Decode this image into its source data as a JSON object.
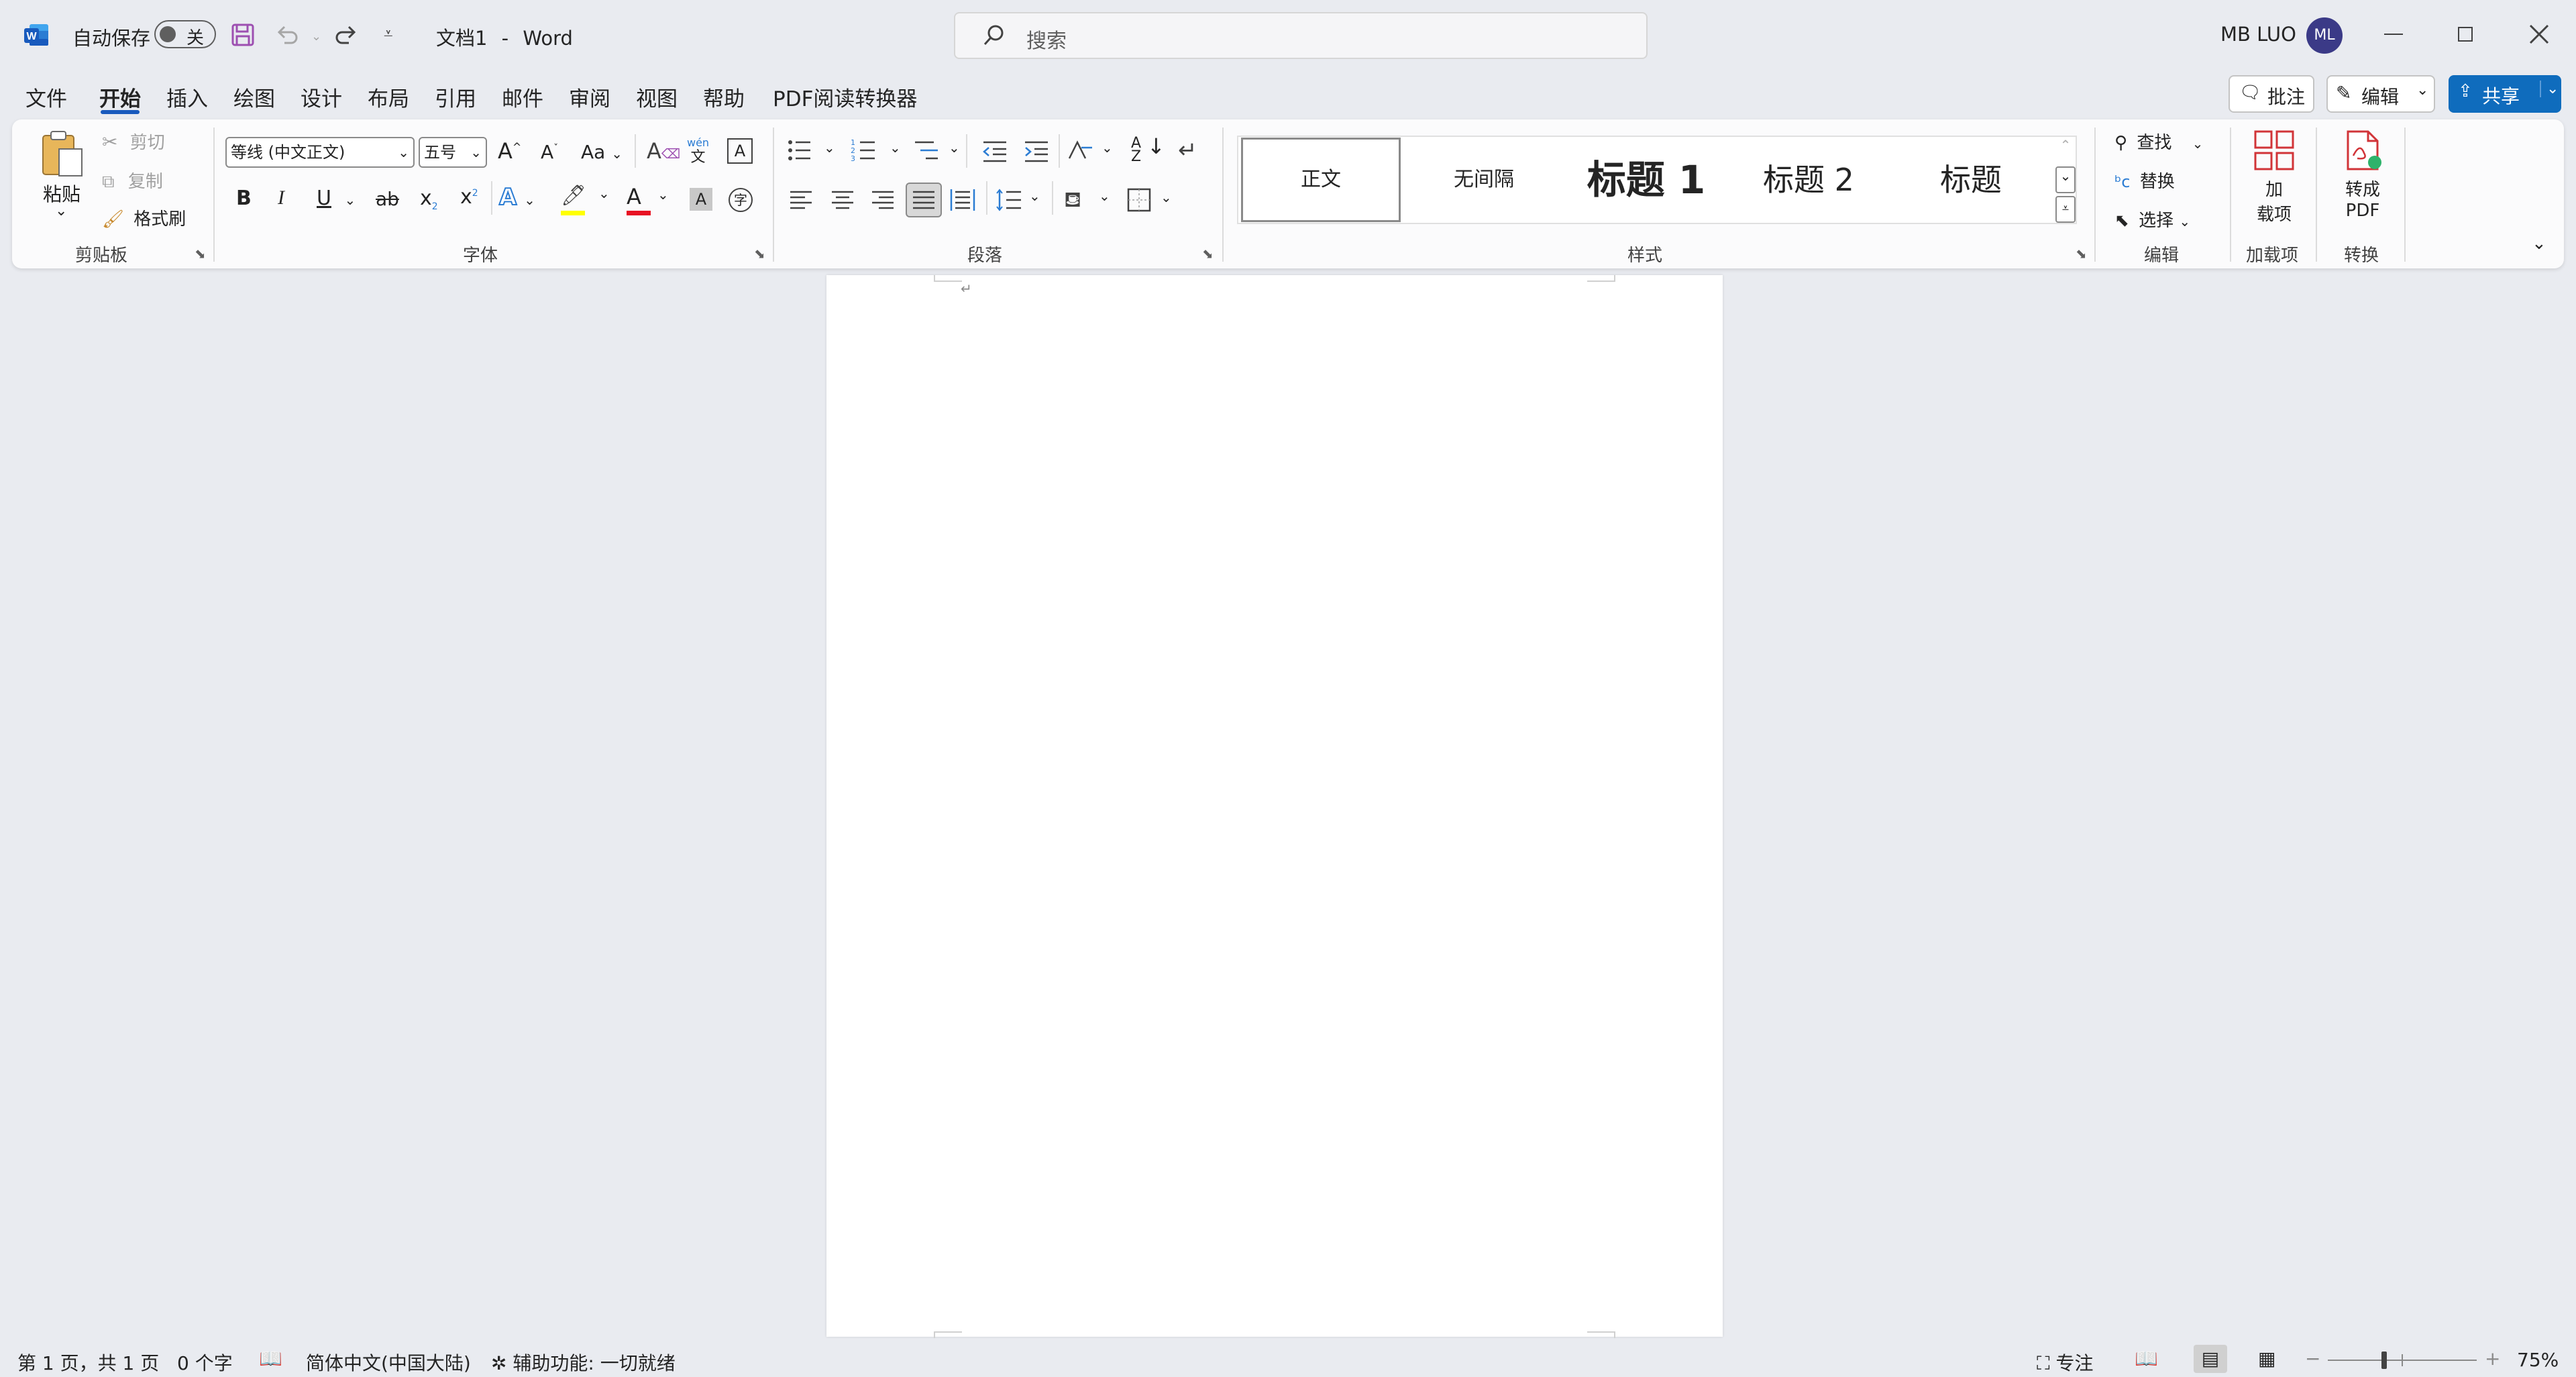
{
  "titlebar": {
    "autosave_label": "自动保存",
    "autosave_state": "关",
    "doc_title": "文档1",
    "separator": "-",
    "app_name": "Word",
    "search_placeholder": "搜索",
    "user_name": "MB LUO",
    "user_initials": "ML"
  },
  "tabs": [
    "文件",
    "开始",
    "插入",
    "绘图",
    "设计",
    "布局",
    "引用",
    "邮件",
    "审阅",
    "视图",
    "帮助",
    "PDF阅读转换器"
  ],
  "active_tab": "开始",
  "actions": {
    "comments": "批注",
    "editing": "编辑",
    "share": "共享"
  },
  "clipboard": {
    "paste": "粘贴",
    "cut": "剪切",
    "copy": "复制",
    "format_painter": "格式刷",
    "label": "剪贴板"
  },
  "font": {
    "font_name": "等线 (中文正文)",
    "font_size": "五号",
    "case_btn": "Aa",
    "phonetic_top": "wén",
    "phonetic_bottom": "文",
    "bold": "B",
    "italic": "I",
    "underline": "U",
    "strike": "ab",
    "subscript": "x",
    "superscript": "x",
    "text_effect": "A",
    "char_shade": "A",
    "enclose": "字",
    "border_char": "A",
    "label": "字体"
  },
  "paragraph": {
    "label": "段落"
  },
  "styles": {
    "items": [
      "正文",
      "无间隔",
      "标题 1",
      "标题 2",
      "标题"
    ],
    "label": "样式"
  },
  "editing": {
    "find": "查找",
    "replace": "替换",
    "select": "选择",
    "label": "编辑"
  },
  "addins": {
    "button_line1": "加",
    "button_line2": "载项",
    "label": "加载项"
  },
  "convert": {
    "button_line1": "转成",
    "button_line2": "PDF",
    "label": "转换"
  },
  "status": {
    "page": "第 1 页，共 1 页",
    "words": "0 个字",
    "language": "简体中文(中国大陆)",
    "accessibility": "辅助功能: 一切就绪",
    "focus": "专注",
    "zoom": "75%",
    "zoom_minus": "−",
    "zoom_plus": "+"
  },
  "colors": {
    "word_blue": "#185abd",
    "share_blue": "#0f6cbd",
    "avatar": "#3b3a87",
    "save_purple": "#9d4fb1",
    "highlight": "#ffff00",
    "font_red": "#e81123",
    "addin_red": "#d13438"
  }
}
